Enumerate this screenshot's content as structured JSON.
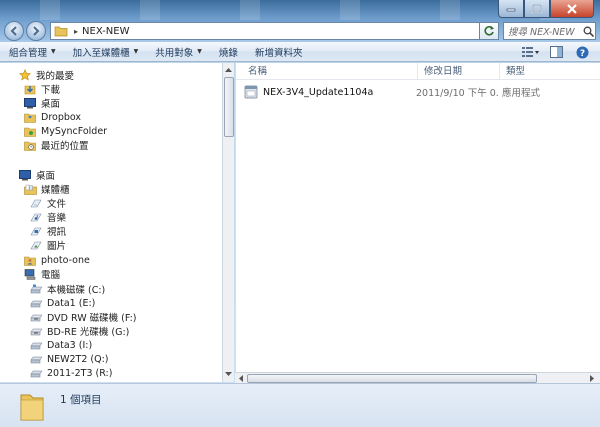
{
  "window": {
    "minimize_icon": "minimize-icon",
    "maximize_icon": "maximize-icon",
    "close_icon": "close-icon"
  },
  "address": {
    "path": "NEX-NEW",
    "separator": "▸"
  },
  "search": {
    "placeholder": "搜尋 NEX-NEW"
  },
  "commands": [
    {
      "label": "組合管理",
      "has_menu": true
    },
    {
      "label": "加入至媒體櫃",
      "has_menu": true
    },
    {
      "label": "共用對象",
      "has_menu": true
    },
    {
      "label": "燒錄",
      "has_menu": false
    },
    {
      "label": "新增資料夾",
      "has_menu": false
    }
  ],
  "nav": {
    "favorites": {
      "header": "我的最愛",
      "items": [
        "下載",
        "桌面",
        "Dropbox",
        "MySyncFolder",
        "最近的位置"
      ]
    },
    "desktop": {
      "header": "桌面",
      "libraries": {
        "label": "媒體櫃",
        "items": [
          "文件",
          "音樂",
          "視訊",
          "圖片"
        ]
      },
      "photo_one": "photo-one",
      "computer": {
        "label": "電腦",
        "drives": [
          "本機磁碟 (C:)",
          "Data1 (E:)",
          "DVD RW 磁碟機 (F:)",
          "BD-RE 光碟機 (G:)",
          "Data3 (I:)",
          "NEW2T2 (Q:)",
          "2011-2T3 (R:)"
        ]
      }
    }
  },
  "columns": {
    "name": "名稱",
    "date": "修改日期",
    "type": "類型"
  },
  "files": [
    {
      "name": "NEX-3V4_Update1104a",
      "date": "2011/9/10 下午 0...",
      "type": "應用程式"
    }
  ],
  "status": {
    "count": "1 個項目"
  },
  "colors": {
    "accent": "#1e395b",
    "window_glass": "#6d9ccb",
    "close_red": "#c7432a"
  }
}
